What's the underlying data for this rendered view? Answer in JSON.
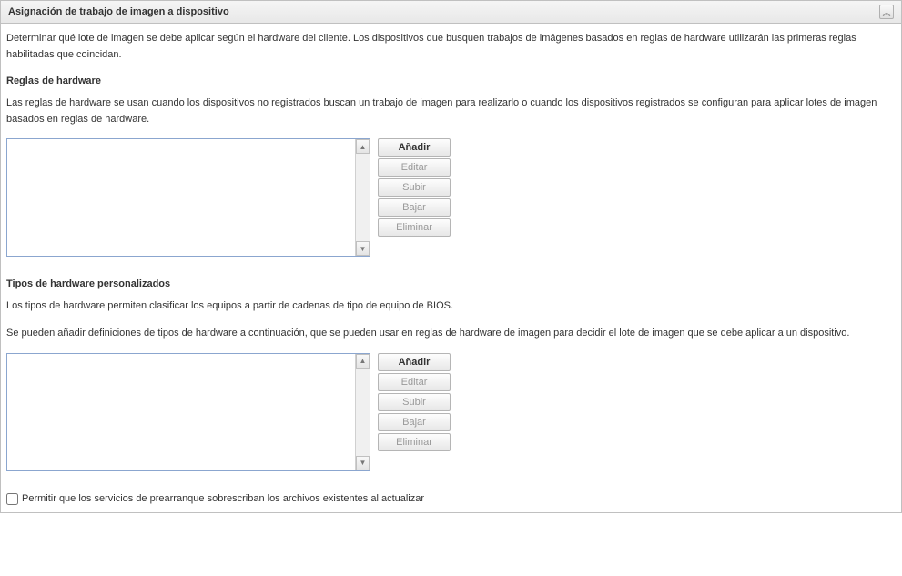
{
  "panel": {
    "title": "Asignación de trabajo de imagen a dispositivo"
  },
  "intro": "Determinar qué lote de imagen se debe aplicar según el hardware del cliente. Los dispositivos que busquen trabajos de imágenes basados en reglas de hardware utilizarán las primeras reglas habilitadas que coincidan.",
  "section1": {
    "heading": "Reglas de hardware",
    "desc": "Las reglas de hardware se usan cuando los dispositivos no registrados buscan un trabajo de imagen para realizarlo o cuando los dispositivos registrados se configuran para aplicar lotes de imagen basados en reglas de hardware.",
    "buttons": {
      "add": "Añadir",
      "edit": "Editar",
      "up": "Subir",
      "down": "Bajar",
      "remove": "Eliminar"
    }
  },
  "section2": {
    "heading": "Tipos de hardware personalizados",
    "desc1": "Los tipos de hardware permiten clasificar los equipos a partir de cadenas de tipo de equipo de BIOS.",
    "desc2": "Se pueden añadir definiciones de tipos de hardware a continuación, que se pueden usar en reglas de hardware de imagen para decidir el lote de imagen que se debe aplicar a un dispositivo.",
    "buttons": {
      "add": "Añadir",
      "edit": "Editar",
      "up": "Subir",
      "down": "Bajar",
      "remove": "Eliminar"
    }
  },
  "checkbox": {
    "label": "Permitir que los servicios de prearranque sobrescriban los archivos existentes al actualizar"
  }
}
